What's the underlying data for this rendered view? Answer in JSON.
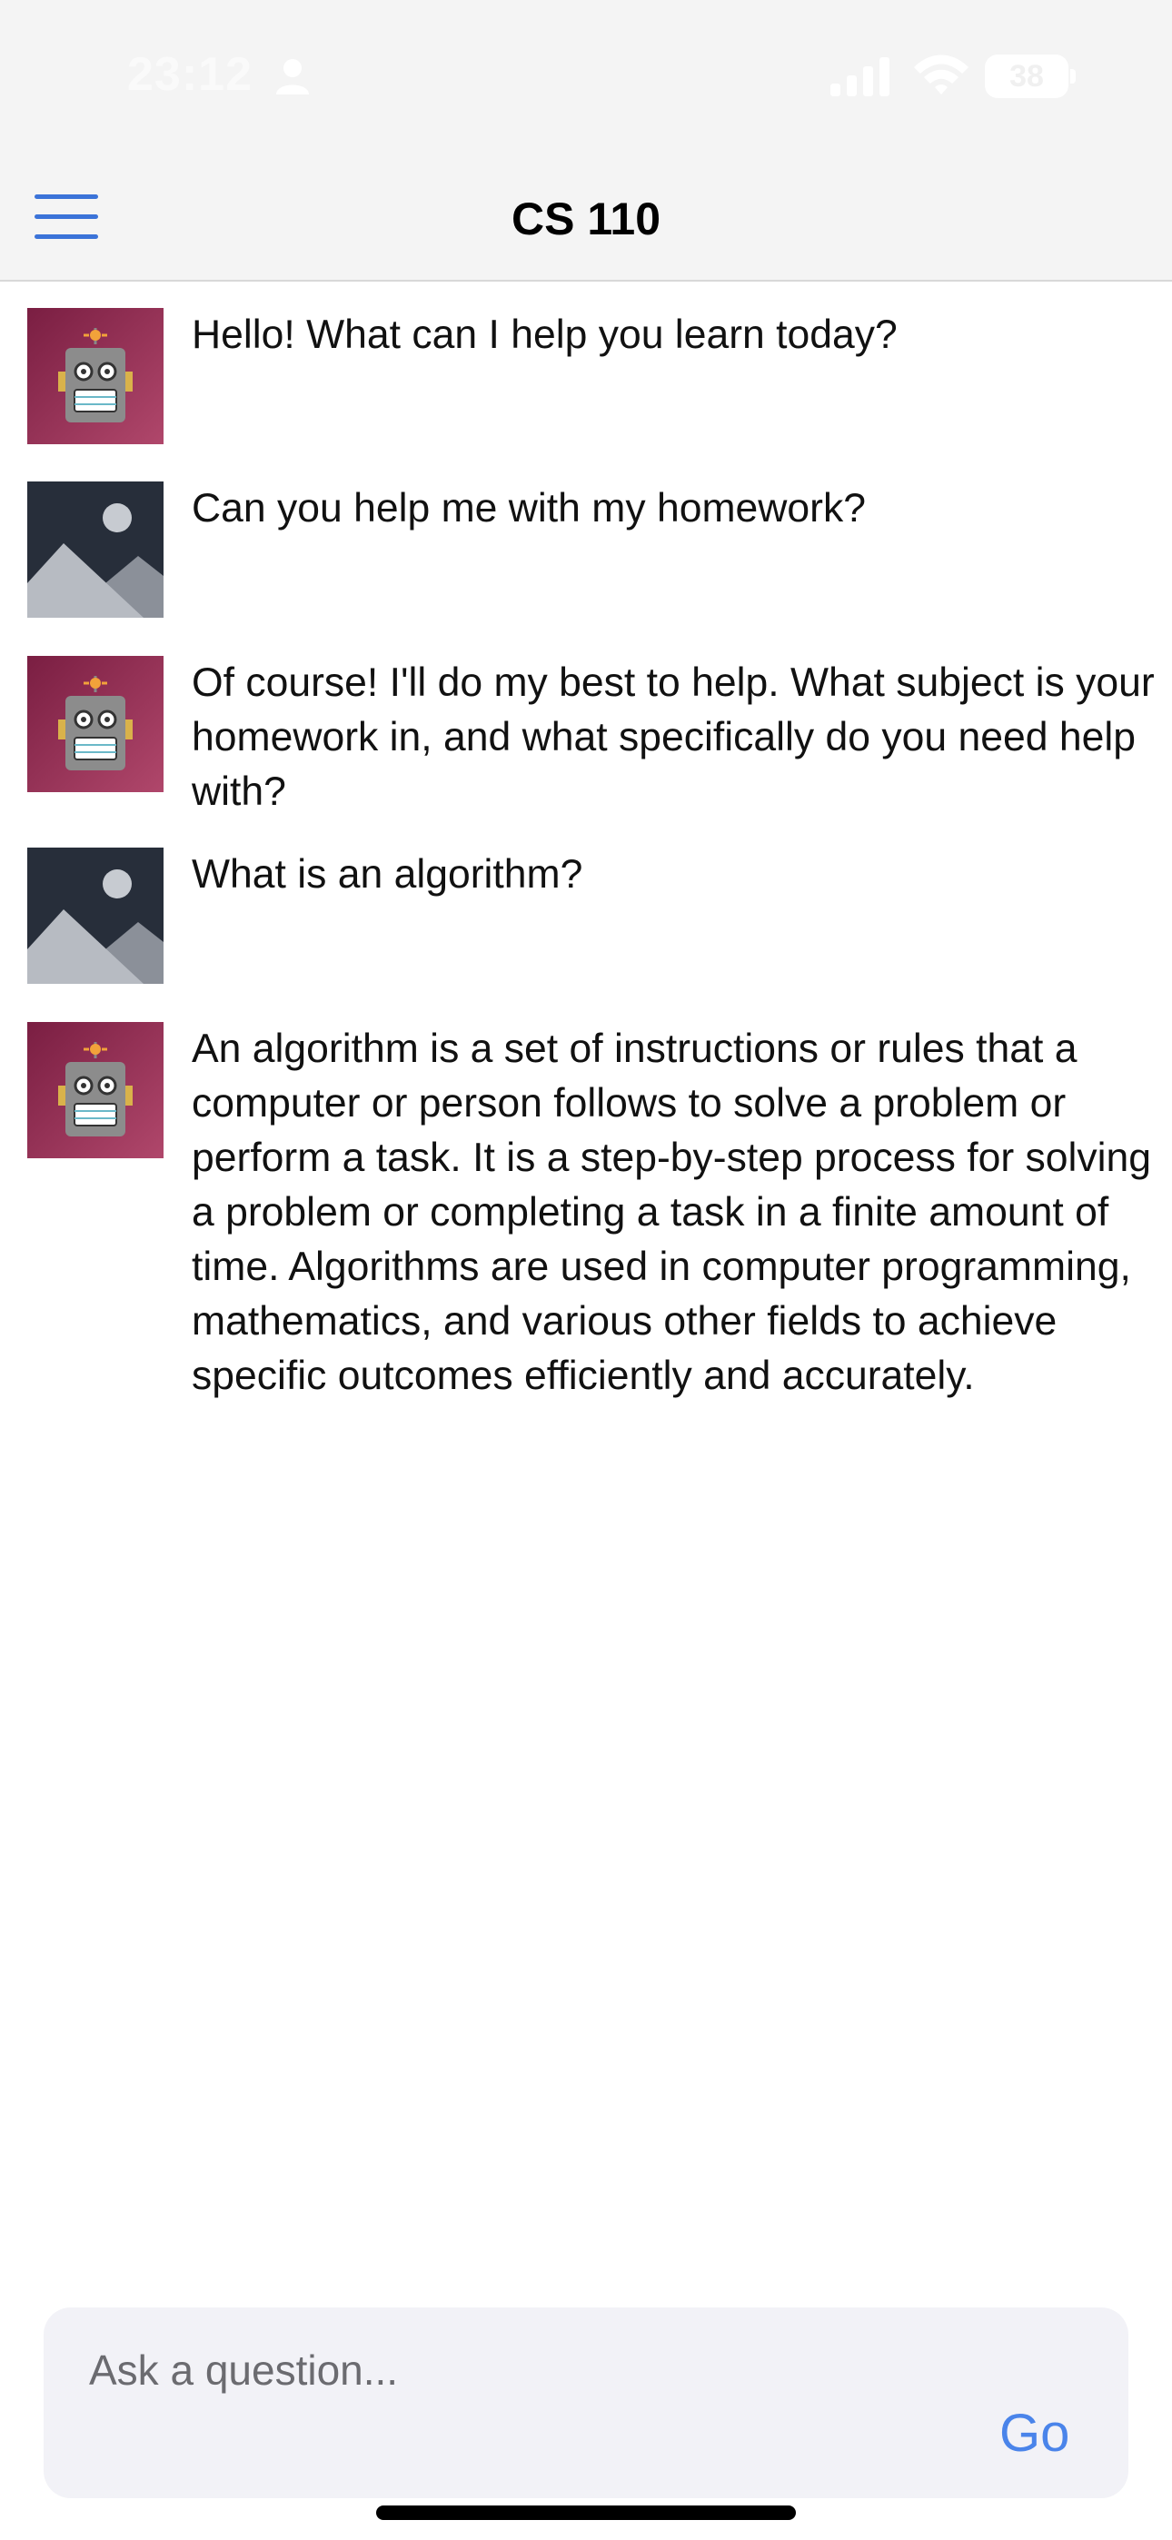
{
  "status_bar": {
    "time": "23:12",
    "battery": "38",
    "icons": [
      "person-icon",
      "cellular-signal-icon",
      "wifi-icon",
      "battery-icon"
    ]
  },
  "nav": {
    "title": "CS 110",
    "menu_icon": "hamburger-menu-icon",
    "accent_color": "#3b73d8"
  },
  "messages": [
    {
      "sender": "bot",
      "avatar_icon": "robot-icon",
      "text": "Hello! What can I help you learn today?"
    },
    {
      "sender": "user",
      "avatar_icon": "image-placeholder-icon",
      "text": "Can you help me with my homework?"
    },
    {
      "sender": "bot",
      "avatar_icon": "robot-icon",
      "text": "Of course! I'll do my best to help. What subject is your homework in, and what specifically do you need help with?"
    },
    {
      "sender": "user",
      "avatar_icon": "image-placeholder-icon",
      "text": "What is an algorithm?"
    },
    {
      "sender": "bot",
      "avatar_icon": "robot-icon",
      "text": "An algorithm is a set of instructions or rules that a computer or person follows to solve a problem or perform a task. It is a step-by-step process for solving a problem or completing a task in a finite amount of time. Algorithms are used in computer programming, mathematics, and various other fields to achieve specific outcomes efficiently and accurately."
    }
  ],
  "composer": {
    "placeholder": "Ask a question...",
    "value": "",
    "go_label": "Go",
    "go_color": "#4a84ea"
  },
  "colors": {
    "bot_avatar_bg": "#8e2a4e",
    "user_avatar_bg": "#272e3a"
  }
}
